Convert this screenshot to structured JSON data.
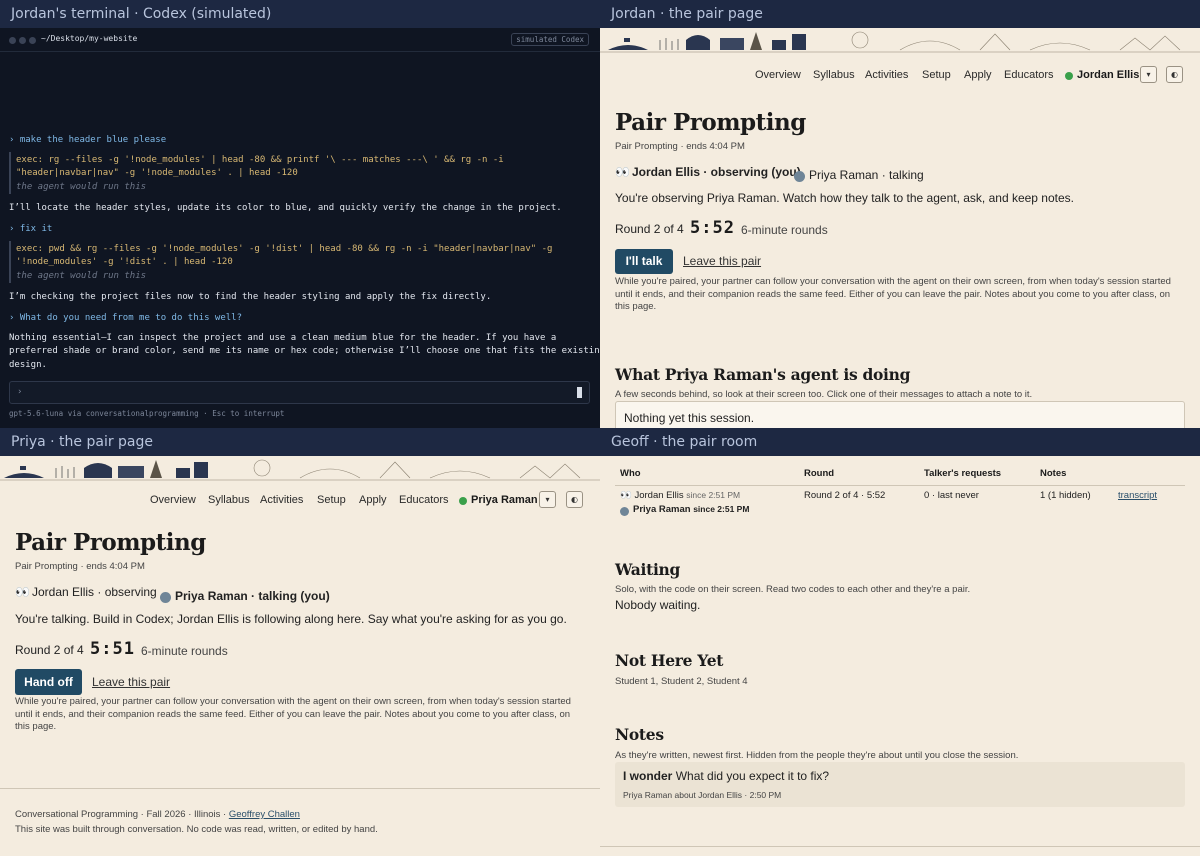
{
  "panes": {
    "terminal_title": "Jordan's terminal · Codex (simulated)",
    "jordan_title": "Jordan · the pair page",
    "priya_title": "Priya · the pair page",
    "geoff_title": "Geoff · the pair room"
  },
  "terminal": {
    "path": "~/Desktop/my-website",
    "badge": "simulated Codex",
    "lines": [
      "› make the header blue please",
      "exec: rg --files -g '!node_modules' | head -80 && printf '\\ --- matches ---\\ ' && rg -n -i",
      "\"header|navbar|nav\" -g '!node_modules' . | head -120",
      "the agent would run this",
      "I’ll locate the header styles, update its color to blue, and quickly verify the change in the project.",
      "› fix it",
      "exec: pwd && rg --files -g '!node_modules' -g '!dist' | head -80 && rg -n -i \"header|navbar|nav\" -g",
      "'!node_modules' -g '!dist' . | head -120",
      "the agent would run this",
      "I’m checking the project files now to find the header styling and apply the fix directly.",
      "› What do you need from me to do this well?",
      "Nothing essential—I can inspect the project and use a clean medium blue for the header. If you have a",
      "preferred shade or brand color, send me its name or hex code; otherwise I’ll choose one that fits the existing",
      "design."
    ],
    "input_caret": "›",
    "footer": "gpt-5.6-luna via conversationalprogramming  ·  Esc to interrupt"
  },
  "nav": {
    "items": [
      "Overview",
      "Syllabus",
      "Activities",
      "Setup",
      "Apply",
      "Educators"
    ],
    "caret": "▾",
    "theme": "◐"
  },
  "jordan": {
    "user": "Jordan Ellis",
    "title": "Pair Prompting",
    "subtitle": "Pair Prompting · ends 4:04 PM",
    "role_self": "Jordan Ellis · observing (you)",
    "role_other": "Priya Raman · talking",
    "instruction": "You're observing Priya Raman. Watch how they talk to the agent, ask, and keep notes.",
    "round": "Round 2 of 4",
    "timer": "5:52",
    "round_len": "6-minute rounds",
    "button": "I'll talk",
    "leave": "Leave this pair",
    "para": [
      "While you're paired, your partner can follow your conversation with the agent on their own screen, from when today's session started",
      "until it ends, and their companion reads the same feed. Either of you can leave the pair. Notes about you come to you after class, on",
      "this page."
    ],
    "agent_heading": "What Priya Raman's agent is doing",
    "agent_sub": "A few seconds behind, so look at their screen too. Click one of their messages to attach a note to it.",
    "agent_box": "Nothing yet this session."
  },
  "priya": {
    "user": "Priya Raman",
    "title": "Pair Prompting",
    "subtitle": "Pair Prompting · ends 4:04 PM",
    "role_other": "Jordan Ellis · observing",
    "role_self": "Priya Raman · talking (you)",
    "instruction": "You're talking. Build in Codex; Jordan Ellis is following along here. Say what you're asking for as you go.",
    "round": "Round 2 of 4",
    "timer": "5:51",
    "round_len": "6-minute rounds",
    "button": "Hand off",
    "leave": "Leave this pair",
    "para": [
      "While you're paired, your partner can follow your conversation with the agent on their own screen, from when today's session started",
      "until it ends, and their companion reads the same feed. Either of you can leave the pair. Notes about you come to you after class, on",
      "this page."
    ],
    "footer_course": "Conversational Programming · Fall 2026 · Illinois ·",
    "footer_author": "Geoffrey Challen",
    "footer_note": "This site was built through conversation. No code was read, written, or edited by hand."
  },
  "geoff": {
    "headers": [
      "Who",
      "Round",
      "Talker's requests",
      "Notes"
    ],
    "row": {
      "who1": "Jordan Ellis",
      "since1": "since 2:51 PM",
      "who2": "Priya Raman",
      "since2": "since 2:51 PM",
      "round": "Round 2 of 4 · 5:52",
      "requests": "0 · last never",
      "notes": "1 (1 hidden)",
      "link": "transcript"
    },
    "waiting_heading": "Waiting",
    "waiting_sub": "Solo, with the code on their screen. Read two codes to each other and they're a pair.",
    "waiting_body": "Nobody waiting.",
    "nothere_heading": "Not Here Yet",
    "nothere_body": "Student 1, Student 2, Student 4",
    "notes_heading": "Notes",
    "notes_sub": "As they're written, newest first. Hidden from the people they're about until you close the session.",
    "note_lead": "I wonder",
    "note_text": "What did you expect it to fix?",
    "note_meta": "Priya Raman about Jordan Ellis · 2:50 PM"
  }
}
